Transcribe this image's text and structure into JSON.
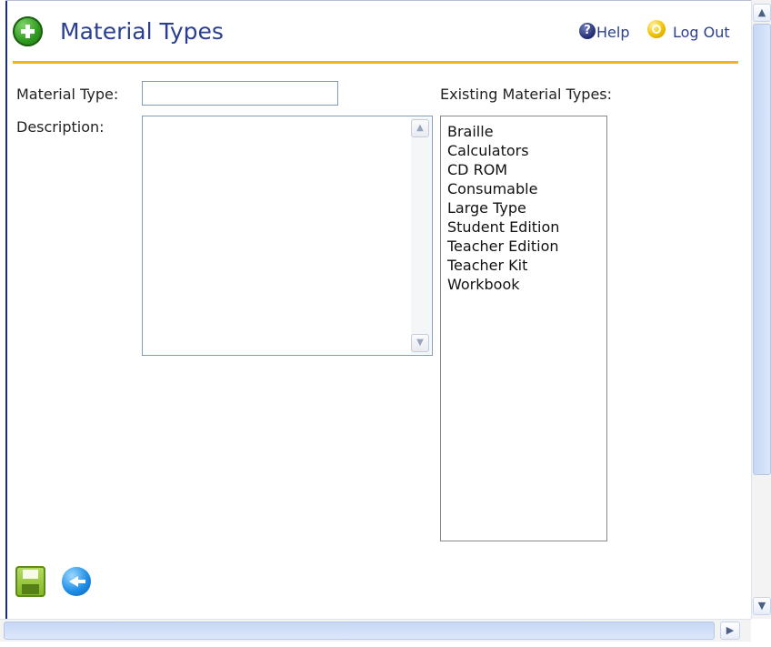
{
  "header": {
    "title": "Material Types",
    "help_label": "Help",
    "logout_label": "Log Out",
    "help_icon_glyph": "?"
  },
  "form": {
    "material_type_label": "Material Type:",
    "material_type_value": "",
    "description_label": "Description:",
    "description_value": ""
  },
  "existing": {
    "label": "Existing Material Types:",
    "items": [
      "Braille",
      "Calculators",
      "CD ROM",
      "Consumable",
      "Large Type",
      "Student Edition",
      "Teacher Edition",
      "Teacher Kit",
      "Workbook"
    ]
  },
  "toolbar": {
    "save_icon": "save-icon",
    "back_icon": "back-icon"
  },
  "colors": {
    "title": "#2a3f8f",
    "rule": "#f2b41e",
    "frame": "#1e2f6e"
  }
}
